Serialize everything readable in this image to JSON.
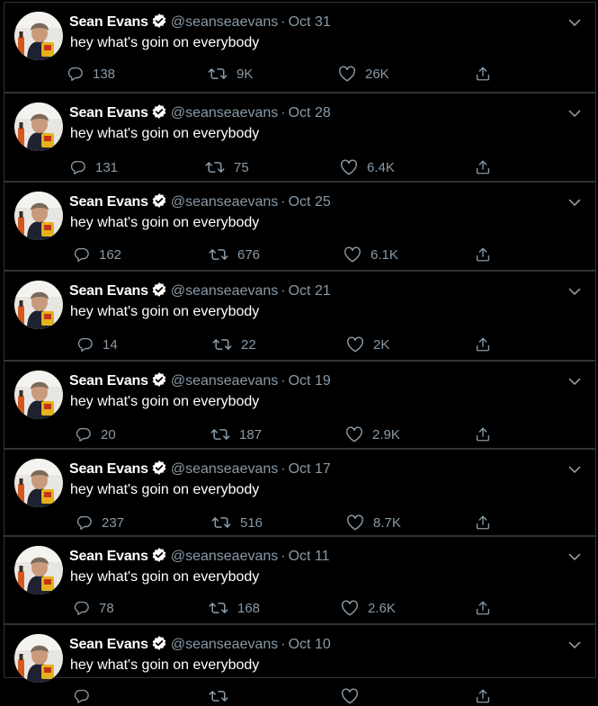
{
  "author": {
    "name": "Sean Evans",
    "handle": "@seanseaevans"
  },
  "tweets": [
    {
      "date": "Oct 31",
      "text": "hey what's goin on everybody",
      "replies": "138",
      "retweets": "9K",
      "likes": "26K"
    },
    {
      "date": "Oct 28",
      "text": "hey what's goin on everybody",
      "replies": "131",
      "retweets": "75",
      "likes": "6.4K"
    },
    {
      "date": "Oct 25",
      "text": "hey what's goin on everybody",
      "replies": "162",
      "retweets": "676",
      "likes": "6.1K"
    },
    {
      "date": "Oct 21",
      "text": "hey what's goin on everybody",
      "replies": "14",
      "retweets": "22",
      "likes": "2K"
    },
    {
      "date": "Oct 19",
      "text": "hey what's goin on everybody",
      "replies": "20",
      "retweets": "187",
      "likes": "2.9K"
    },
    {
      "date": "Oct 17",
      "text": "hey what's goin on everybody",
      "replies": "237",
      "retweets": "516",
      "likes": "8.7K"
    },
    {
      "date": "Oct 11",
      "text": "hey what's goin on everybody",
      "replies": "78",
      "retweets": "168",
      "likes": "2.6K"
    },
    {
      "date": "Oct 10",
      "text": "hey what's goin on everybody",
      "replies": "",
      "retweets": "",
      "likes": ""
    }
  ],
  "icons": {
    "verified": "verified-badge-icon",
    "more": "chevron-down-icon",
    "reply": "reply-icon",
    "retweet": "retweet-icon",
    "like": "heart-icon",
    "share": "share-icon"
  },
  "colors": {
    "background": "#000000",
    "text": "#ffffff",
    "muted": "#8899a6",
    "border": "#2f3336"
  }
}
